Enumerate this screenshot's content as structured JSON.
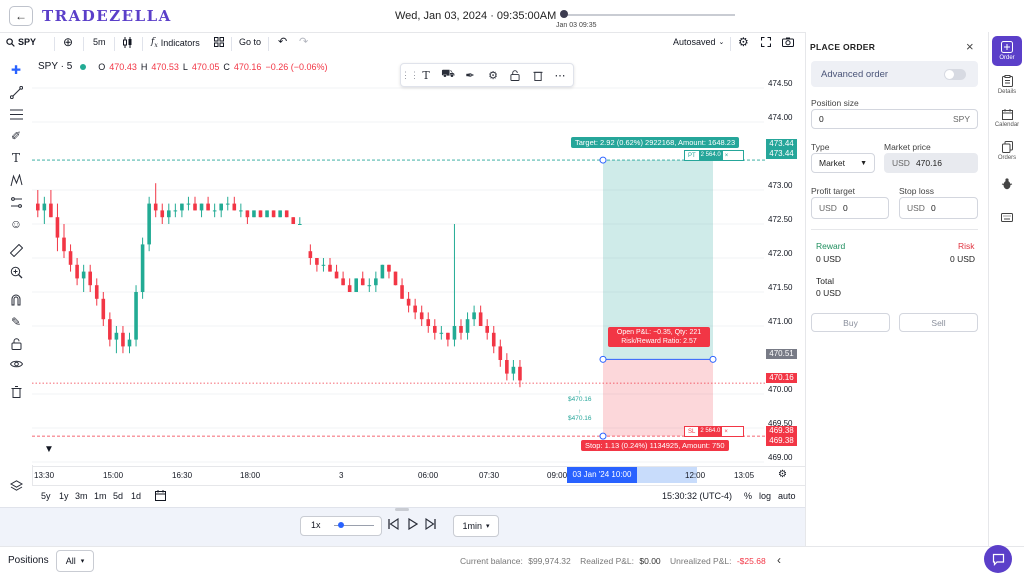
{
  "header": {
    "logo": "TRADEZELLA",
    "datetime": "Wed, Jan 03, 2024 · 09:35:00AM",
    "replay_label": "Jan 03 09:35"
  },
  "toolbar": {
    "symbol": "SPY",
    "interval": "5m",
    "indicators": "Indicators",
    "goto": "Go to",
    "autosaved": "Autosaved"
  },
  "legend": {
    "title": "SPY · 5",
    "o_label": "O",
    "o": "470.43",
    "h_label": "H",
    "h": "470.53",
    "l_label": "L",
    "l": "470.05",
    "c_label": "C",
    "c": "470.16",
    "change": "−0.26 (−0.06%)"
  },
  "chart_data": {
    "type": "candlestick",
    "symbol": "SPY",
    "interval": "5",
    "ylim": [
      469.0,
      474.6
    ],
    "y_ticks": [
      474.5,
      474.0,
      473.0,
      472.5,
      472.0,
      471.5,
      471.0,
      470.0,
      469.5,
      469.0
    ],
    "x_ticks": [
      "13:30",
      "15:00",
      "16:30",
      "18:00",
      "3",
      "06:00",
      "07:30",
      "09:00",
      "12:00",
      "13:05"
    ],
    "candles": [
      [
        472.8,
        473.0,
        472.6,
        472.7
      ],
      [
        472.7,
        472.9,
        472.5,
        472.8
      ],
      [
        472.8,
        473.0,
        472.6,
        472.6
      ],
      [
        472.6,
        472.8,
        472.1,
        472.3
      ],
      [
        472.3,
        472.5,
        472.0,
        472.1
      ],
      [
        472.1,
        472.2,
        471.8,
        471.9
      ],
      [
        471.9,
        472.0,
        471.6,
        471.7
      ],
      [
        471.7,
        471.9,
        471.5,
        471.8
      ],
      [
        471.8,
        471.9,
        471.5,
        471.6
      ],
      [
        471.6,
        471.7,
        471.3,
        471.4
      ],
      [
        471.4,
        471.5,
        471.0,
        471.1
      ],
      [
        471.1,
        471.2,
        470.7,
        470.8
      ],
      [
        470.8,
        471.0,
        470.6,
        470.9
      ],
      [
        470.9,
        471.0,
        470.6,
        470.7
      ],
      [
        470.7,
        470.9,
        470.6,
        470.8
      ],
      [
        470.8,
        471.6,
        470.7,
        471.5
      ],
      [
        471.5,
        472.3,
        471.4,
        472.2
      ],
      [
        472.2,
        472.9,
        472.1,
        472.8
      ],
      [
        472.8,
        473.1,
        472.6,
        472.7
      ],
      [
        472.7,
        472.8,
        472.5,
        472.6
      ],
      [
        472.6,
        472.8,
        472.5,
        472.7
      ],
      [
        472.7,
        472.8,
        472.6,
        472.7
      ],
      [
        472.7,
        472.8,
        472.6,
        472.8
      ],
      [
        472.8,
        472.9,
        472.7,
        472.8
      ],
      [
        472.8,
        472.9,
        472.7,
        472.7
      ],
      [
        472.7,
        472.8,
        472.6,
        472.8
      ],
      [
        472.8,
        472.9,
        472.7,
        472.7
      ],
      [
        472.7,
        472.8,
        472.6,
        472.7
      ],
      [
        472.7,
        472.8,
        472.6,
        472.8
      ],
      [
        472.8,
        472.9,
        472.7,
        472.8
      ],
      [
        472.8,
        472.9,
        472.7,
        472.7
      ],
      [
        472.7,
        472.8,
        472.6,
        472.7
      ],
      [
        472.7,
        472.7,
        472.5,
        472.6
      ],
      [
        472.6,
        472.7,
        472.6,
        472.7
      ],
      [
        472.7,
        472.7,
        472.6,
        472.6
      ],
      [
        472.6,
        472.7,
        472.6,
        472.7
      ],
      [
        472.7,
        472.7,
        472.6,
        472.6
      ],
      [
        472.6,
        472.7,
        472.6,
        472.7
      ],
      [
        472.7,
        472.7,
        472.6,
        472.6
      ],
      [
        472.6,
        472.6,
        472.5,
        472.5
      ],
      [
        472.5,
        472.6,
        472.5,
        472.5
      ],
      [
        472.1,
        472.2,
        471.9,
        472.0
      ],
      [
        472.0,
        472.0,
        471.8,
        471.9
      ],
      [
        471.9,
        472.0,
        471.8,
        471.9
      ],
      [
        471.9,
        472.0,
        471.8,
        471.8
      ],
      [
        471.8,
        471.9,
        471.7,
        471.7
      ],
      [
        471.7,
        471.8,
        471.6,
        471.6
      ],
      [
        471.6,
        471.7,
        471.5,
        471.5
      ],
      [
        471.5,
        471.7,
        471.5,
        471.7
      ],
      [
        471.7,
        471.8,
        471.6,
        471.6
      ],
      [
        471.6,
        471.7,
        471.5,
        471.6
      ],
      [
        471.6,
        471.8,
        471.5,
        471.7
      ],
      [
        471.7,
        471.9,
        471.7,
        471.9
      ],
      [
        471.9,
        471.9,
        471.7,
        471.8
      ],
      [
        471.8,
        471.8,
        471.6,
        471.6
      ],
      [
        471.6,
        471.7,
        471.4,
        471.4
      ],
      [
        471.4,
        471.5,
        471.2,
        471.3
      ],
      [
        471.3,
        471.4,
        471.1,
        471.2
      ],
      [
        471.2,
        471.3,
        471.0,
        471.1
      ],
      [
        471.1,
        471.2,
        470.9,
        471.0
      ],
      [
        471.0,
        471.1,
        470.8,
        470.9
      ],
      [
        470.9,
        471.0,
        470.8,
        470.9
      ],
      [
        470.9,
        470.9,
        470.7,
        470.8
      ],
      [
        470.8,
        472.5,
        470.7,
        471.0
      ],
      [
        471.0,
        471.1,
        470.8,
        470.9
      ],
      [
        470.9,
        471.2,
        470.8,
        471.1
      ],
      [
        471.1,
        471.3,
        471.0,
        471.2
      ],
      [
        471.2,
        471.3,
        471.0,
        471.0
      ],
      [
        471.0,
        471.1,
        470.8,
        470.9
      ],
      [
        470.9,
        471.0,
        470.6,
        470.7
      ],
      [
        470.7,
        470.8,
        470.4,
        470.5
      ],
      [
        470.5,
        470.6,
        470.2,
        470.3
      ],
      [
        470.3,
        470.5,
        470.2,
        470.4
      ],
      [
        470.4,
        470.5,
        470.1,
        470.2
      ]
    ]
  },
  "position_tool": {
    "target_label": "Target: 2.92 (0.62%) 2922168, Amount: 1648.23",
    "center_label_1": "Open P&L: −0.35, Qty: 221",
    "center_label_2": "Risk/Reward Ratio: 2.57",
    "stop_label": "Stop: 1.13 (0.24%) 1134925, Amount: 750",
    "pt_tag": "PT",
    "pt_value": "2 564.0",
    "sl_tag": "SL",
    "sl_value": "2 564.0",
    "entry_price": "470.51",
    "target_price": "473.44",
    "stop_price": "469.38",
    "current_price": "470.16",
    "trade_marker_1": "$470.16",
    "trade_marker_2": "$470.16",
    "current_time": "03 Jan '24   10:00",
    "colors": {
      "profit": "#26a69a",
      "loss": "#f23645"
    }
  },
  "y_axis_labels": [
    "474.50",
    "474.00",
    "473.00",
    "472.50",
    "472.00",
    "471.50",
    "471.00",
    "470.00",
    "469.50",
    "469.00"
  ],
  "x_axis_labels": [
    "13:30",
    "15:00",
    "16:30",
    "18:00",
    "3",
    "06:00",
    "07:30",
    "09:00",
    "12:00",
    "13:05"
  ],
  "timeframes": [
    "5y",
    "1y",
    "3m",
    "1m",
    "5d",
    "1d"
  ],
  "time_display": "15:30:32 (UTC-4)",
  "scale_options": [
    "%",
    "log",
    "auto"
  ],
  "playback": {
    "speed": "1x",
    "interval": "1min"
  },
  "footer": {
    "positions": "Positions",
    "filter": "All",
    "balance_label": "Current balance:",
    "balance": "$99,974.32",
    "realized_label": "Realized P&L:",
    "realized": "$0.00",
    "unrealized_label": "Unrealized P&L:",
    "unrealized": "-$25.68"
  },
  "order_panel": {
    "title": "PLACE ORDER",
    "advanced": "Advanced order",
    "position_size_label": "Position size",
    "position_size_value": "0",
    "position_size_unit": "SPY",
    "type_label": "Type",
    "type_value": "Market",
    "market_price_label": "Market price",
    "market_price_currency": "USD",
    "market_price_value": "470.16",
    "profit_target_label": "Profit target",
    "profit_target_currency": "USD",
    "profit_target_value": "0",
    "stop_loss_label": "Stop loss",
    "stop_loss_currency": "USD",
    "stop_loss_value": "0",
    "reward_label": "Reward",
    "reward_value": "0 USD",
    "risk_label": "Risk",
    "risk_value": "0 USD",
    "total_label": "Total",
    "total_value": "0 USD",
    "buy": "Buy",
    "sell": "Sell"
  },
  "rail": {
    "order": "Order",
    "details": "Details",
    "calendar": "Calendar",
    "orders": "Orders"
  }
}
